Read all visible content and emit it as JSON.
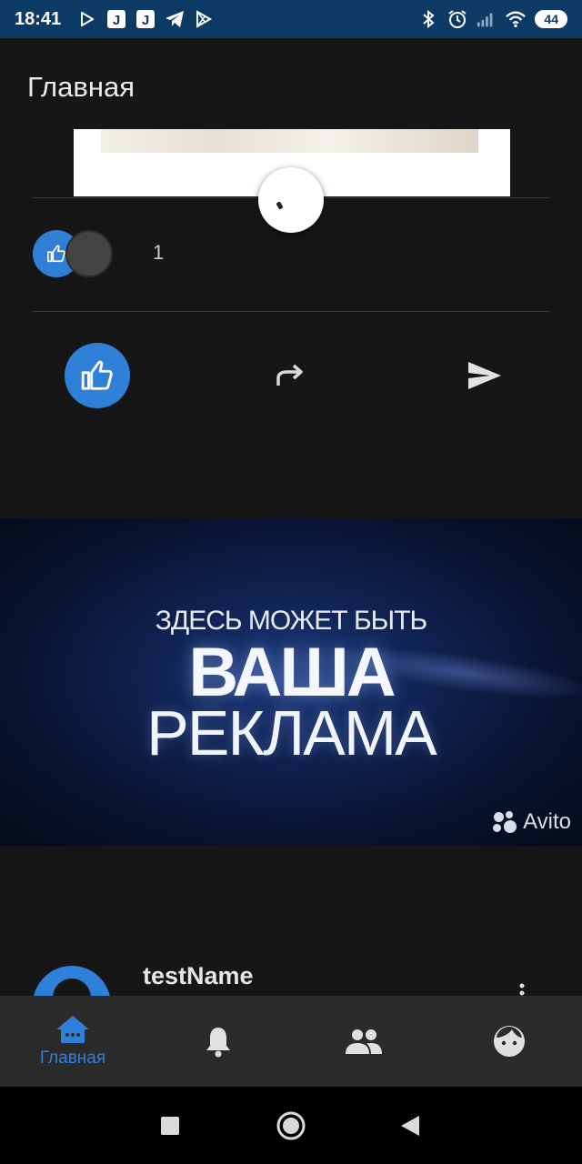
{
  "status_bar": {
    "time": "18:41",
    "battery": "44",
    "left_icons": [
      "play-store-notification-icon",
      "j-app-icon",
      "j-app-icon",
      "telegram-icon",
      "play-icon"
    ],
    "right_icons": [
      "bluetooth-icon",
      "alarm-icon",
      "signal-icon",
      "wifi-icon"
    ]
  },
  "header": {
    "title": "Главная"
  },
  "post1": {
    "reactions_count": "1"
  },
  "ad": {
    "line1": "ЗДЕСЬ МОЖЕТ БЫТЬ",
    "line2": "ВАША",
    "line3": "РЕКЛАМА",
    "brand": "Avito"
  },
  "post2": {
    "author": "testName"
  },
  "bottom_nav": {
    "items": [
      {
        "label": "Главная",
        "icon": "home-icon",
        "active": true
      },
      {
        "label": "",
        "icon": "bell-icon",
        "active": false
      },
      {
        "label": "",
        "icon": "people-icon",
        "active": false
      },
      {
        "label": "",
        "icon": "face-icon",
        "active": false
      }
    ]
  },
  "colors": {
    "accent": "#2f80d8",
    "background": "#161616",
    "status_bar": "#0d3b66",
    "nav_bar": "#2b2b2b"
  }
}
